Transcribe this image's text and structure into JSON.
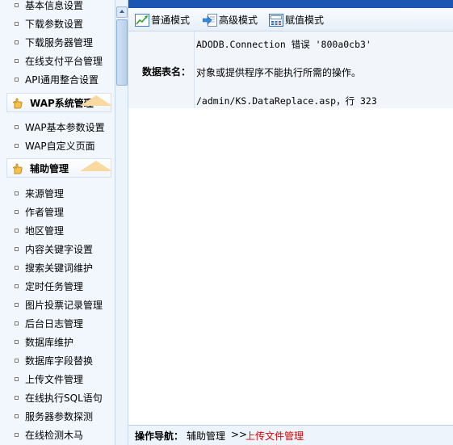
{
  "sidebar": {
    "items_top": [
      "基本信息设置",
      "下载参数设置",
      "下载服务器管理",
      "在线支付平台管理",
      "API通用整合设置"
    ],
    "group_wap": {
      "title": "WAP系统管理",
      "items": [
        "WAP基本参数设置",
        "WAP自定义页面"
      ]
    },
    "group_aux": {
      "title": "辅助管理",
      "items": [
        "来源管理",
        "作者管理",
        "地区管理",
        "内容关键字设置",
        "搜索关键词维护",
        "定时任务管理",
        "图片投票记录管理",
        "后台日志管理",
        "数据库维护",
        "数据库字段替换",
        "上传文件管理",
        "在线执行SQL语句",
        "服务器参数探测",
        "在线检测木马"
      ]
    }
  },
  "toolbar": {
    "normal_mode": "普通模式",
    "advanced_mode": "高级模式",
    "assign_mode": "赋值模式"
  },
  "form": {
    "label": "数据表名：",
    "error_line1": "ADODB.Connection 错误 '800a0cb3'",
    "error_line2": "对象或提供程序不能执行所需的操作。",
    "error_line3": "/admin/KS.DataReplace.asp，行 323"
  },
  "footer": {
    "nav_label": "操作导航：",
    "crumb1": "辅助管理",
    "separator": ">>",
    "crumb2": "上传文件管理"
  },
  "colors": {
    "accent_blue": "#1b56b3",
    "current_crumb": "#e00000",
    "panel_bg": "#f2f6fb"
  }
}
